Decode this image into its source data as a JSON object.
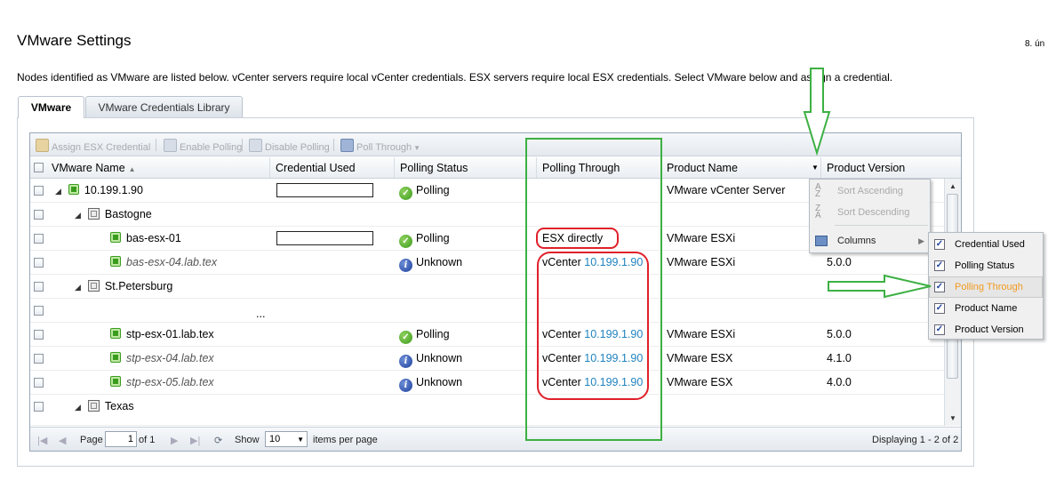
{
  "page": {
    "title": "VMware Settings",
    "date_cut": "8. ún",
    "description": "Nodes identified as VMware are listed below. vCenter servers require local vCenter credentials. ESX servers require local ESX credentials. Select VMware below and assign a credential."
  },
  "tabs": [
    {
      "label": "VMware",
      "active": true
    },
    {
      "label": "VMware Credentials Library",
      "active": false
    }
  ],
  "toolbar": {
    "assign": "Assign ESX Credential",
    "enable": "Enable Polling",
    "disable": "Disable Polling",
    "poll_through": "Poll Through"
  },
  "columns": {
    "name": "VMware Name",
    "cred": "Credential Used",
    "status": "Polling Status",
    "through": "Polling Through",
    "product": "Product Name",
    "version": "Product Version"
  },
  "rows": [
    {
      "name": "10.199.1.90",
      "status": "Polling",
      "through_prefix": "",
      "through_link": "",
      "product": "VMware vCenter Server",
      "version": ""
    },
    {
      "name": "Bastogne"
    },
    {
      "name": "bas-esx-01",
      "status": "Polling",
      "through_prefix": "ESX directly",
      "through_link": "",
      "product": "VMware ESXi",
      "version": ""
    },
    {
      "name": "bas-esx-04.lab.tex",
      "status": "Unknown",
      "through_prefix": "vCenter ",
      "through_link": "10.199.1.90",
      "product": "VMware ESXi",
      "version": "5.0.0"
    },
    {
      "name": "St.Petersburg"
    },
    {
      "name": "..."
    },
    {
      "name": "stp-esx-01.lab.tex",
      "status": "Polling",
      "through_prefix": "vCenter ",
      "through_link": "10.199.1.90",
      "product": "VMware ESXi",
      "version": "5.0.0"
    },
    {
      "name": "stp-esx-04.lab.tex",
      "status": "Unknown",
      "through_prefix": "vCenter ",
      "through_link": "10.199.1.90",
      "product": "VMware ESX",
      "version": "4.1.0"
    },
    {
      "name": "stp-esx-05.lab.tex",
      "status": "Unknown",
      "through_prefix": "vCenter ",
      "through_link": "10.199.1.90",
      "product": "VMware ESX",
      "version": "4.0.0"
    },
    {
      "name": "Texas"
    }
  ],
  "pager": {
    "page_label": "Page",
    "page_value": "1",
    "of_label": "of 1",
    "show_label": "Show",
    "show_value": "10",
    "per_page_label": "items per page",
    "displaying": "Displaying 1 - 2 of 2"
  },
  "column_menu": {
    "sort_asc": "Sort Ascending",
    "sort_desc": "Sort Descending",
    "columns": "Columns"
  },
  "columns_submenu": [
    {
      "label": "Credential Used",
      "checked": true
    },
    {
      "label": "Polling Status",
      "checked": true
    },
    {
      "label": "Polling Through",
      "checked": true,
      "highlighted": true
    },
    {
      "label": "Product Name",
      "checked": true
    },
    {
      "label": "Product Version",
      "checked": true
    }
  ],
  "colors": {
    "link": "#1f82c0",
    "highlight_text": "#f29a1f",
    "annotation_green": "#3cb043",
    "annotation_red": "#e0202a"
  }
}
